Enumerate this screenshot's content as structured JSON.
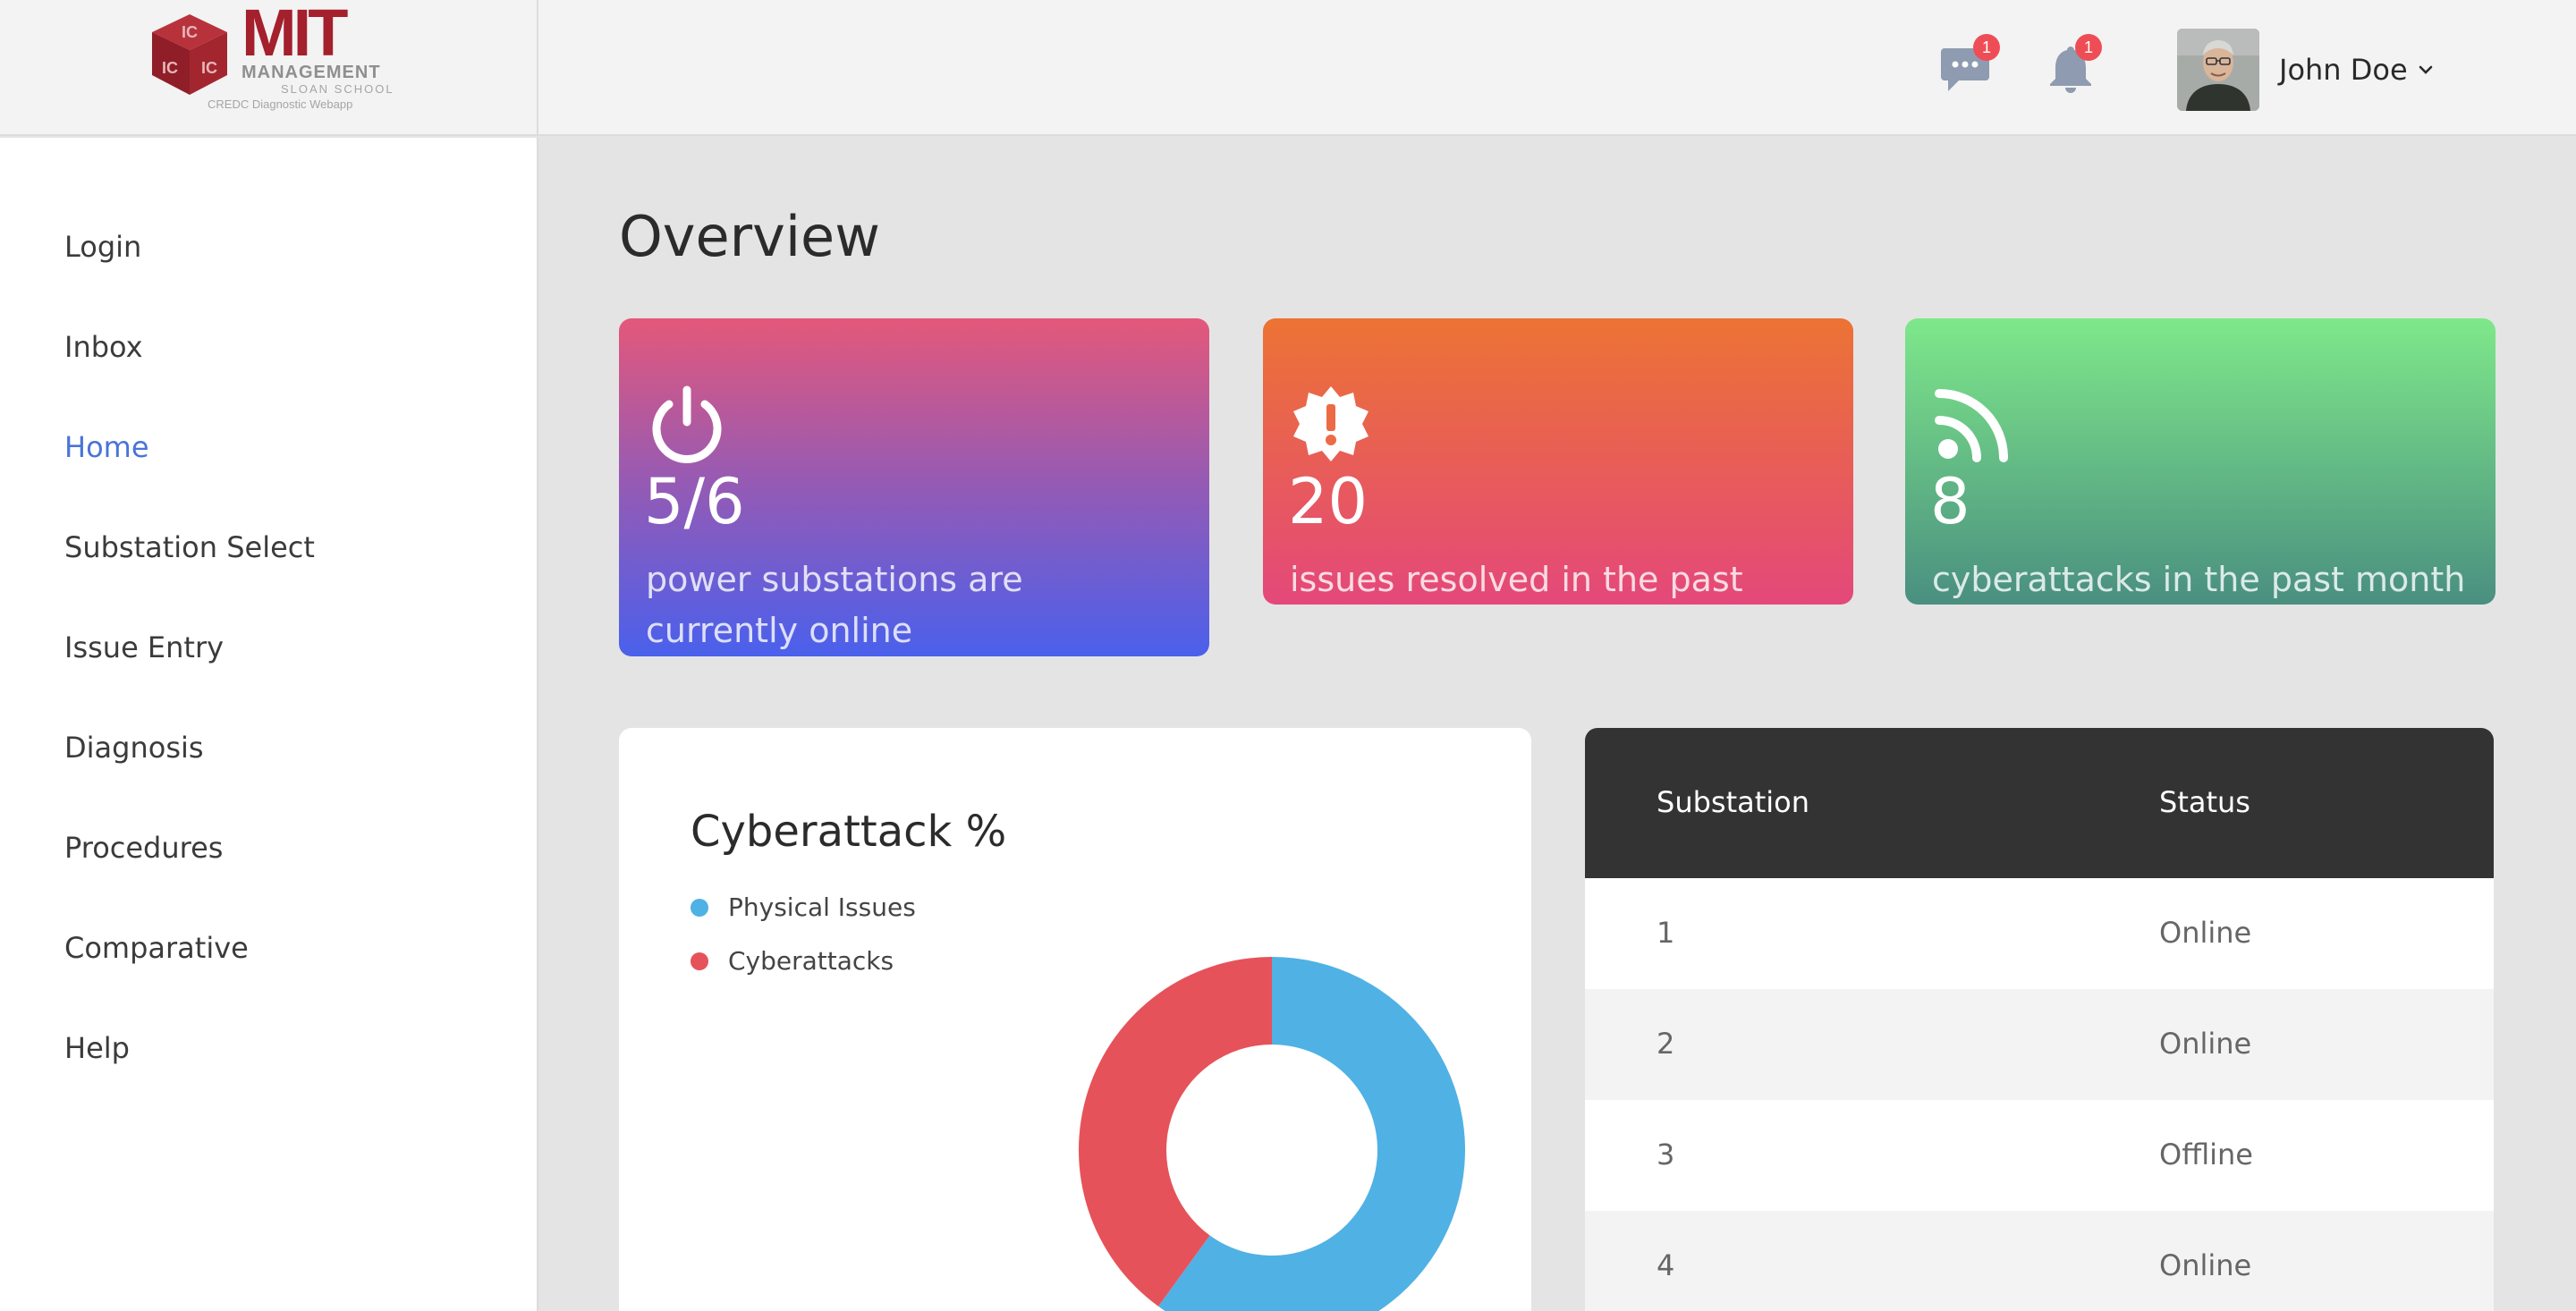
{
  "header": {
    "logo": {
      "cube_text": "IC IC IC",
      "mit": "MIT",
      "management": "MANAGEMENT",
      "sloan": "SLOAN SCHOOL",
      "caption": "CREDC Diagnostic Webapp"
    },
    "messages_badge": "1",
    "notifications_badge": "1",
    "user_name": "John Doe"
  },
  "sidebar": {
    "items": [
      {
        "label": "Login"
      },
      {
        "label": "Inbox"
      },
      {
        "label": "Home"
      },
      {
        "label": "Substation Select"
      },
      {
        "label": "Issue Entry"
      },
      {
        "label": "Diagnosis"
      },
      {
        "label": "Procedures"
      },
      {
        "label": "Comparative"
      },
      {
        "label": "Help"
      }
    ],
    "active": "Home"
  },
  "main": {
    "title": "Overview",
    "cards": [
      {
        "icon": "power-icon",
        "value": "5/6",
        "text": "power substations are currently online"
      },
      {
        "icon": "alert-badge-icon",
        "value": "20",
        "text": "issues resolved in the past month"
      },
      {
        "icon": "rss-icon",
        "value": "8",
        "text": "cyberattacks in the past month"
      }
    ],
    "chart": {
      "title": "Cyberattack %",
      "legend": [
        {
          "label": "Physical Issues",
          "color": "#50b1e4"
        },
        {
          "label": "Cyberattacks",
          "color": "#e6525a"
        }
      ]
    },
    "table": {
      "headers": [
        "Substation",
        "Status"
      ],
      "rows": [
        [
          "1",
          "Online"
        ],
        [
          "2",
          "Online"
        ],
        [
          "3",
          "Offline"
        ],
        [
          "4",
          "Online"
        ]
      ]
    }
  },
  "chart_data": {
    "type": "pie",
    "title": "Cyberattack %",
    "series": [
      {
        "name": "Physical Issues",
        "value": 60,
        "color": "#50b1e4"
      },
      {
        "name": "Cyberattacks",
        "value": 40,
        "color": "#e6525a"
      }
    ],
    "legend": "top-left"
  },
  "colors": {
    "accent": "#4a74d9",
    "badge": "#ef4d56",
    "table_header": "#333333"
  }
}
